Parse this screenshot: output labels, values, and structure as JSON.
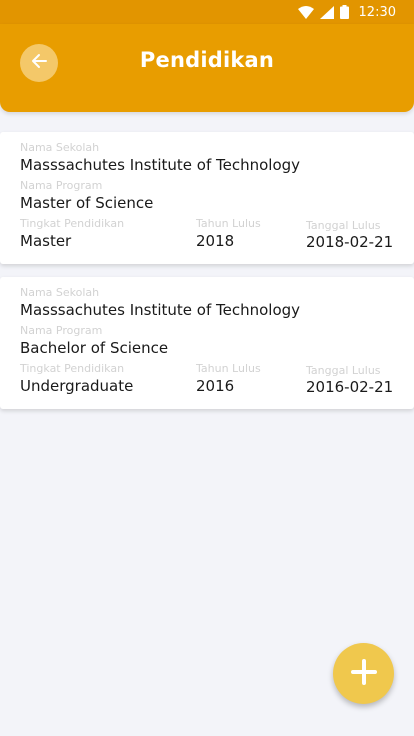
{
  "status_bar": {
    "time": "12:30",
    "icons": [
      "wifi-icon",
      "signal-icon",
      "battery-icon"
    ]
  },
  "app_bar": {
    "title": "Pendidikan",
    "back_icon": "arrow-left-icon"
  },
  "colors": {
    "primary": "#e89d00",
    "status_bar": "#e29500",
    "back_button": "#f4c869",
    "fab": "#f0c84d",
    "background": "#f3f4f9",
    "label": "#d2d2d2"
  },
  "education": [
    {
      "school_label": "Nama Sekolah",
      "school": "Masssachutes Institute of Technology",
      "program_label": "Nama Program",
      "program": "Master of Science",
      "level_label": "Tingkat Pendidikan",
      "level": "Master",
      "year_label": "Tahun Lulus",
      "year": "2018",
      "date_label": "Tanggal Lulus",
      "date": "2018-02-21"
    },
    {
      "school_label": "Nama Sekolah",
      "school": "Masssachutes Institute of Technology",
      "program_label": "Nama Program",
      "program": "Bachelor of Science",
      "level_label": "Tingkat Pendidikan",
      "level": "Undergraduate",
      "year_label": "Tahun Lulus",
      "year": "2016",
      "date_label": "Tanggal Lulus",
      "date": "2016-02-21"
    }
  ],
  "fab": {
    "icon": "plus-icon"
  }
}
